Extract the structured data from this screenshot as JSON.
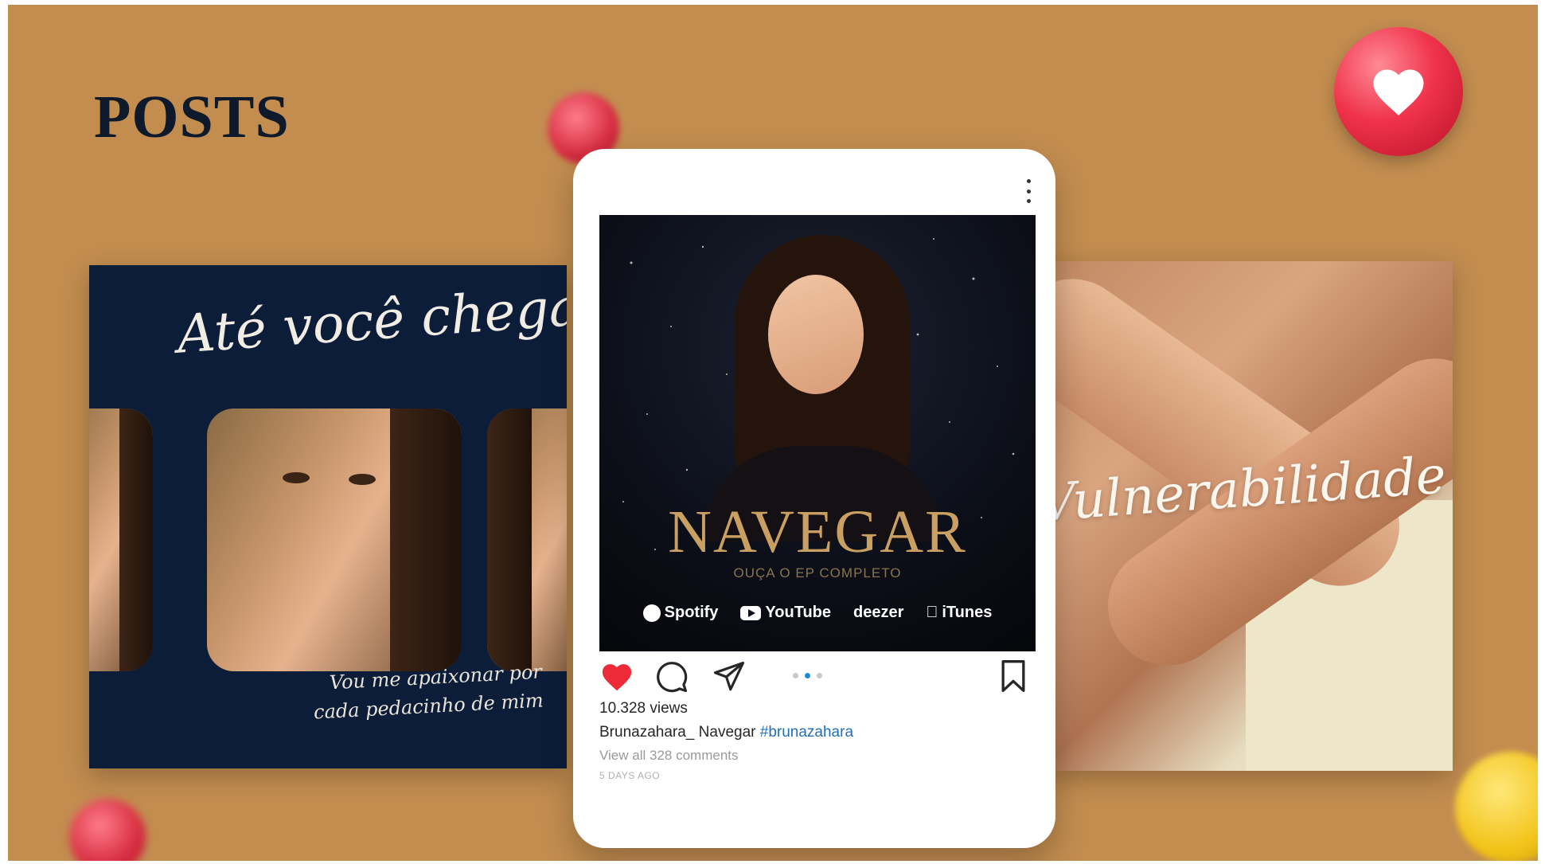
{
  "page": {
    "title": "POSTS",
    "accent_color": "#c38d50",
    "dark_color": "#0c1d39"
  },
  "left_post": {
    "script_title": "Até você chegar",
    "script_caption_line1": "Vou me apaixonar por",
    "script_caption_line2": "cada pedacinho de mim"
  },
  "right_post": {
    "script_title": "Vulnerabilidade"
  },
  "instagram_post": {
    "image": {
      "title": "NAVEGAR",
      "subtitle": "OUÇA O EP COMPLETO",
      "platforms": [
        "Spotify",
        "YouTube",
        "deezer",
        "iTunes"
      ]
    },
    "icons": {
      "more": "more-vertical-icon",
      "like": "heart-filled-icon",
      "comment": "comment-icon",
      "share": "send-icon",
      "save": "bookmark-icon"
    },
    "like_color": "#ed2a38",
    "carousel": {
      "count": 3,
      "active_index": 1
    },
    "views": "10.328 views",
    "caption_user": "Brunazahara_",
    "caption_text": "Navegar",
    "caption_hashtag": "#brunazahara",
    "comments_link": "View all 328 comments",
    "time_ago": "5 DAYS AGO"
  }
}
